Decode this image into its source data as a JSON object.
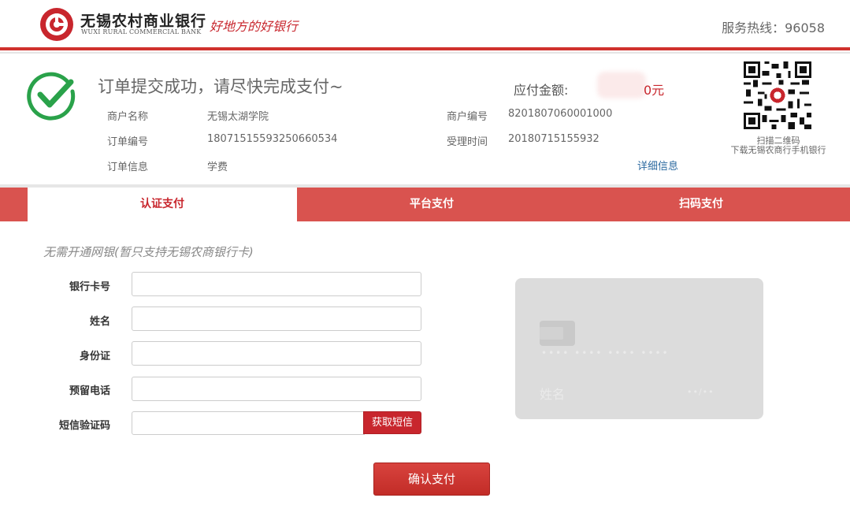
{
  "header": {
    "bank_name_cn": "无锡农村商业银行",
    "bank_name_en": "WUXI RURAL COMMERCIAL BANK",
    "slogan": "好地方的好银行",
    "hotline": "服务热线：96058"
  },
  "order": {
    "title": "订单提交成功，请尽快完成支付~",
    "amount_label": "应付金额:",
    "amount_value": "0元",
    "merchant_name_label": "商户名称",
    "merchant_name": "无锡太湖学院",
    "merchant_no_label": "商户编号",
    "merchant_no": "8201807060001000",
    "order_no_label": "订单编号",
    "order_no": "18071515593250660534",
    "accept_time_label": "受理时间",
    "accept_time": "20180715155932",
    "order_info_label": "订单信息",
    "order_info": "学费",
    "detail_link": "详细信息",
    "qr_caption_1": "扫描二维码",
    "qr_caption_2": "下载无锡农商行手机银行"
  },
  "tabs": [
    {
      "label": "认证支付",
      "active": true
    },
    {
      "label": "平台支付",
      "active": false
    },
    {
      "label": "扫码支付",
      "active": false
    }
  ],
  "form": {
    "notice": "无需开通网银(暂只支持无锡农商银行卡)",
    "card_label": "银行卡号",
    "name_label": "姓名",
    "id_label": "身份证",
    "phone_label": "预留电话",
    "sms_label": "短信验证码",
    "sms_button": "获取短信",
    "confirm_button": "确认支付"
  },
  "card": {
    "number": "•••• •••• •••• ••••",
    "name": "姓名",
    "expiry": "••/••"
  },
  "colors": {
    "brand_red": "#c8262d",
    "tab_red": "#d9534f",
    "success_green": "#2aa24a",
    "link_blue": "#2c6aa0"
  }
}
